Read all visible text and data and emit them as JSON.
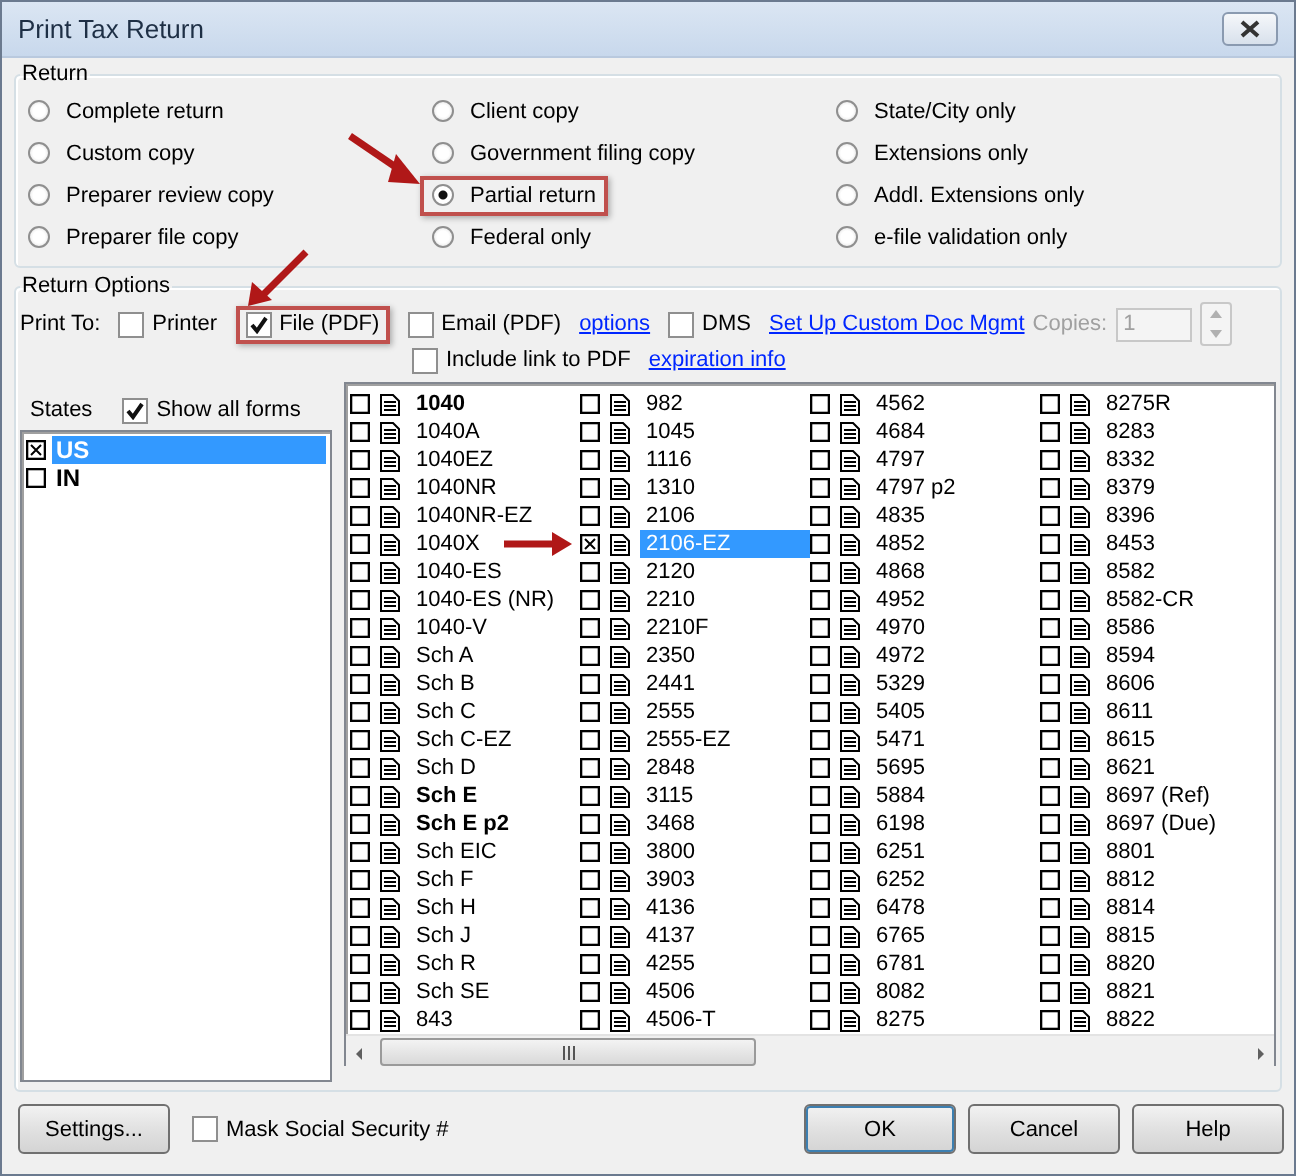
{
  "window": {
    "title": "Print Tax Return"
  },
  "return_group": {
    "title": "Return",
    "options": [
      {
        "label": "Complete return",
        "selected": false,
        "highlighted": false
      },
      {
        "label": "Custom copy",
        "selected": false,
        "highlighted": false
      },
      {
        "label": "Preparer review copy",
        "selected": false,
        "highlighted": false
      },
      {
        "label": "Preparer file copy",
        "selected": false,
        "highlighted": false
      },
      {
        "label": "Client copy",
        "selected": false,
        "highlighted": false
      },
      {
        "label": "Government filing copy",
        "selected": false,
        "highlighted": false
      },
      {
        "label": "Partial return",
        "selected": true,
        "highlighted": true
      },
      {
        "label": "Federal only",
        "selected": false,
        "highlighted": false
      },
      {
        "label": "State/City only",
        "selected": false,
        "highlighted": false
      },
      {
        "label": "Extensions only",
        "selected": false,
        "highlighted": false
      },
      {
        "label": "Addl. Extensions only",
        "selected": false,
        "highlighted": false
      },
      {
        "label": "e-file validation only",
        "selected": false,
        "highlighted": false
      }
    ]
  },
  "options_group": {
    "title": "Return Options",
    "print_to": {
      "label": "Print To:",
      "items": [
        {
          "label": "Printer",
          "checked": false,
          "highlighted": false
        },
        {
          "label": "File (PDF)",
          "checked": true,
          "highlighted": true
        },
        {
          "label": "Email (PDF)",
          "checked": false,
          "highlighted": false,
          "link": "options"
        },
        {
          "label": "DMS",
          "checked": false,
          "highlighted": false,
          "link": "Set Up Custom Doc Mgmt"
        }
      ]
    },
    "include_link": {
      "label": "Include link to PDF",
      "checked": false,
      "link": "expiration info"
    },
    "copies": {
      "label": "Copies:",
      "value": "1",
      "disabled": true
    },
    "states": {
      "label": "States",
      "show_all": {
        "label": "Show all forms",
        "checked": true
      },
      "items": [
        {
          "label": "US",
          "checked": true,
          "selected": true
        },
        {
          "label": "IN",
          "checked": false,
          "selected": false
        }
      ]
    },
    "form_columns": [
      {
        "items": [
          {
            "label": "1040",
            "checked": false,
            "selected": false,
            "bold": true,
            "pointed": false
          },
          {
            "label": "1040A",
            "checked": false,
            "selected": false,
            "bold": false,
            "pointed": false
          },
          {
            "label": "1040EZ",
            "checked": false,
            "selected": false,
            "bold": false,
            "pointed": false
          },
          {
            "label": "1040NR",
            "checked": false,
            "selected": false,
            "bold": false,
            "pointed": false
          },
          {
            "label": "1040NR-EZ",
            "checked": false,
            "selected": false,
            "bold": false,
            "pointed": false
          },
          {
            "label": "1040X",
            "checked": false,
            "selected": false,
            "bold": false,
            "pointed": false
          },
          {
            "label": "1040-ES",
            "checked": false,
            "selected": false,
            "bold": false,
            "pointed": false
          },
          {
            "label": "1040-ES (NR)",
            "checked": false,
            "selected": false,
            "bold": false,
            "pointed": false
          },
          {
            "label": "1040-V",
            "checked": false,
            "selected": false,
            "bold": false,
            "pointed": false
          },
          {
            "label": "Sch A",
            "checked": false,
            "selected": false,
            "bold": false,
            "pointed": false
          },
          {
            "label": "Sch B",
            "checked": false,
            "selected": false,
            "bold": false,
            "pointed": false
          },
          {
            "label": "Sch C",
            "checked": false,
            "selected": false,
            "bold": false,
            "pointed": false
          },
          {
            "label": "Sch C-EZ",
            "checked": false,
            "selected": false,
            "bold": false,
            "pointed": false
          },
          {
            "label": "Sch D",
            "checked": false,
            "selected": false,
            "bold": false,
            "pointed": false
          },
          {
            "label": "Sch E",
            "checked": false,
            "selected": false,
            "bold": true,
            "pointed": false
          },
          {
            "label": "Sch E p2",
            "checked": false,
            "selected": false,
            "bold": true,
            "pointed": false
          },
          {
            "label": "Sch EIC",
            "checked": false,
            "selected": false,
            "bold": false,
            "pointed": false
          },
          {
            "label": "Sch F",
            "checked": false,
            "selected": false,
            "bold": false,
            "pointed": false
          },
          {
            "label": "Sch H",
            "checked": false,
            "selected": false,
            "bold": false,
            "pointed": false
          },
          {
            "label": "Sch J",
            "checked": false,
            "selected": false,
            "bold": false,
            "pointed": false
          },
          {
            "label": "Sch R",
            "checked": false,
            "selected": false,
            "bold": false,
            "pointed": false
          },
          {
            "label": "Sch SE",
            "checked": false,
            "selected": false,
            "bold": false,
            "pointed": false
          },
          {
            "label": "843",
            "checked": false,
            "selected": false,
            "bold": false,
            "pointed": false
          }
        ]
      },
      {
        "items": [
          {
            "label": "982",
            "checked": false,
            "selected": false,
            "bold": false,
            "pointed": false
          },
          {
            "label": "1045",
            "checked": false,
            "selected": false,
            "bold": false,
            "pointed": false
          },
          {
            "label": "1116",
            "checked": false,
            "selected": false,
            "bold": false,
            "pointed": false
          },
          {
            "label": "1310",
            "checked": false,
            "selected": false,
            "bold": false,
            "pointed": false
          },
          {
            "label": "2106",
            "checked": false,
            "selected": false,
            "bold": false,
            "pointed": false
          },
          {
            "label": "2106-EZ",
            "checked": true,
            "selected": true,
            "bold": false,
            "pointed": true
          },
          {
            "label": "2120",
            "checked": false,
            "selected": false,
            "bold": false,
            "pointed": false
          },
          {
            "label": "2210",
            "checked": false,
            "selected": false,
            "bold": false,
            "pointed": false
          },
          {
            "label": "2210F",
            "checked": false,
            "selected": false,
            "bold": false,
            "pointed": false
          },
          {
            "label": "2350",
            "checked": false,
            "selected": false,
            "bold": false,
            "pointed": false
          },
          {
            "label": "2441",
            "checked": false,
            "selected": false,
            "bold": false,
            "pointed": false
          },
          {
            "label": "2555",
            "checked": false,
            "selected": false,
            "bold": false,
            "pointed": false
          },
          {
            "label": "2555-EZ",
            "checked": false,
            "selected": false,
            "bold": false,
            "pointed": false
          },
          {
            "label": "2848",
            "checked": false,
            "selected": false,
            "bold": false,
            "pointed": false
          },
          {
            "label": "3115",
            "checked": false,
            "selected": false,
            "bold": false,
            "pointed": false
          },
          {
            "label": "3468",
            "checked": false,
            "selected": false,
            "bold": false,
            "pointed": false
          },
          {
            "label": "3800",
            "checked": false,
            "selected": false,
            "bold": false,
            "pointed": false
          },
          {
            "label": "3903",
            "checked": false,
            "selected": false,
            "bold": false,
            "pointed": false
          },
          {
            "label": "4136",
            "checked": false,
            "selected": false,
            "bold": false,
            "pointed": false
          },
          {
            "label": "4137",
            "checked": false,
            "selected": false,
            "bold": false,
            "pointed": false
          },
          {
            "label": "4255",
            "checked": false,
            "selected": false,
            "bold": false,
            "pointed": false
          },
          {
            "label": "4506",
            "checked": false,
            "selected": false,
            "bold": false,
            "pointed": false
          },
          {
            "label": "4506-T",
            "checked": false,
            "selected": false,
            "bold": false,
            "pointed": false
          }
        ]
      },
      {
        "items": [
          {
            "label": "4562",
            "checked": false,
            "selected": false,
            "bold": false,
            "pointed": false
          },
          {
            "label": "4684",
            "checked": false,
            "selected": false,
            "bold": false,
            "pointed": false
          },
          {
            "label": "4797",
            "checked": false,
            "selected": false,
            "bold": false,
            "pointed": false
          },
          {
            "label": "4797 p2",
            "checked": false,
            "selected": false,
            "bold": false,
            "pointed": false
          },
          {
            "label": "4835",
            "checked": false,
            "selected": false,
            "bold": false,
            "pointed": false
          },
          {
            "label": "4852",
            "checked": false,
            "selected": false,
            "bold": false,
            "pointed": false
          },
          {
            "label": "4868",
            "checked": false,
            "selected": false,
            "bold": false,
            "pointed": false
          },
          {
            "label": "4952",
            "checked": false,
            "selected": false,
            "bold": false,
            "pointed": false
          },
          {
            "label": "4970",
            "checked": false,
            "selected": false,
            "bold": false,
            "pointed": false
          },
          {
            "label": "4972",
            "checked": false,
            "selected": false,
            "bold": false,
            "pointed": false
          },
          {
            "label": "5329",
            "checked": false,
            "selected": false,
            "bold": false,
            "pointed": false
          },
          {
            "label": "5405",
            "checked": false,
            "selected": false,
            "bold": false,
            "pointed": false
          },
          {
            "label": "5471",
            "checked": false,
            "selected": false,
            "bold": false,
            "pointed": false
          },
          {
            "label": "5695",
            "checked": false,
            "selected": false,
            "bold": false,
            "pointed": false
          },
          {
            "label": "5884",
            "checked": false,
            "selected": false,
            "bold": false,
            "pointed": false
          },
          {
            "label": "6198",
            "checked": false,
            "selected": false,
            "bold": false,
            "pointed": false
          },
          {
            "label": "6251",
            "checked": false,
            "selected": false,
            "bold": false,
            "pointed": false
          },
          {
            "label": "6252",
            "checked": false,
            "selected": false,
            "bold": false,
            "pointed": false
          },
          {
            "label": "6478",
            "checked": false,
            "selected": false,
            "bold": false,
            "pointed": false
          },
          {
            "label": "6765",
            "checked": false,
            "selected": false,
            "bold": false,
            "pointed": false
          },
          {
            "label": "6781",
            "checked": false,
            "selected": false,
            "bold": false,
            "pointed": false
          },
          {
            "label": "8082",
            "checked": false,
            "selected": false,
            "bold": false,
            "pointed": false
          },
          {
            "label": "8275",
            "checked": false,
            "selected": false,
            "bold": false,
            "pointed": false
          }
        ]
      },
      {
        "items": [
          {
            "label": "8275R",
            "checked": false,
            "selected": false,
            "bold": false,
            "pointed": false
          },
          {
            "label": "8283",
            "checked": false,
            "selected": false,
            "bold": false,
            "pointed": false
          },
          {
            "label": "8332",
            "checked": false,
            "selected": false,
            "bold": false,
            "pointed": false
          },
          {
            "label": "8379",
            "checked": false,
            "selected": false,
            "bold": false,
            "pointed": false
          },
          {
            "label": "8396",
            "checked": false,
            "selected": false,
            "bold": false,
            "pointed": false
          },
          {
            "label": "8453",
            "checked": false,
            "selected": false,
            "bold": false,
            "pointed": false
          },
          {
            "label": "8582",
            "checked": false,
            "selected": false,
            "bold": false,
            "pointed": false
          },
          {
            "label": "8582-CR",
            "checked": false,
            "selected": false,
            "bold": false,
            "pointed": false
          },
          {
            "label": "8586",
            "checked": false,
            "selected": false,
            "bold": false,
            "pointed": false
          },
          {
            "label": "8594",
            "checked": false,
            "selected": false,
            "bold": false,
            "pointed": false
          },
          {
            "label": "8606",
            "checked": false,
            "selected": false,
            "bold": false,
            "pointed": false
          },
          {
            "label": "8611",
            "checked": false,
            "selected": false,
            "bold": false,
            "pointed": false
          },
          {
            "label": "8615",
            "checked": false,
            "selected": false,
            "bold": false,
            "pointed": false
          },
          {
            "label": "8621",
            "checked": false,
            "selected": false,
            "bold": false,
            "pointed": false
          },
          {
            "label": "8697 (Ref)",
            "checked": false,
            "selected": false,
            "bold": false,
            "pointed": false
          },
          {
            "label": "8697 (Due)",
            "checked": false,
            "selected": false,
            "bold": false,
            "pointed": false
          },
          {
            "label": "8801",
            "checked": false,
            "selected": false,
            "bold": false,
            "pointed": false
          },
          {
            "label": "8812",
            "checked": false,
            "selected": false,
            "bold": false,
            "pointed": false
          },
          {
            "label": "8814",
            "checked": false,
            "selected": false,
            "bold": false,
            "pointed": false
          },
          {
            "label": "8815",
            "checked": false,
            "selected": false,
            "bold": false,
            "pointed": false
          },
          {
            "label": "8820",
            "checked": false,
            "selected": false,
            "bold": false,
            "pointed": false
          },
          {
            "label": "8821",
            "checked": false,
            "selected": false,
            "bold": false,
            "pointed": false
          },
          {
            "label": "8822",
            "checked": false,
            "selected": false,
            "bold": false,
            "pointed": false
          }
        ]
      }
    ]
  },
  "footer": {
    "settings": "Settings...",
    "mask": {
      "label": "Mask Social Security #",
      "checked": false
    },
    "buttons": [
      "OK",
      "Cancel",
      "Help"
    ]
  }
}
